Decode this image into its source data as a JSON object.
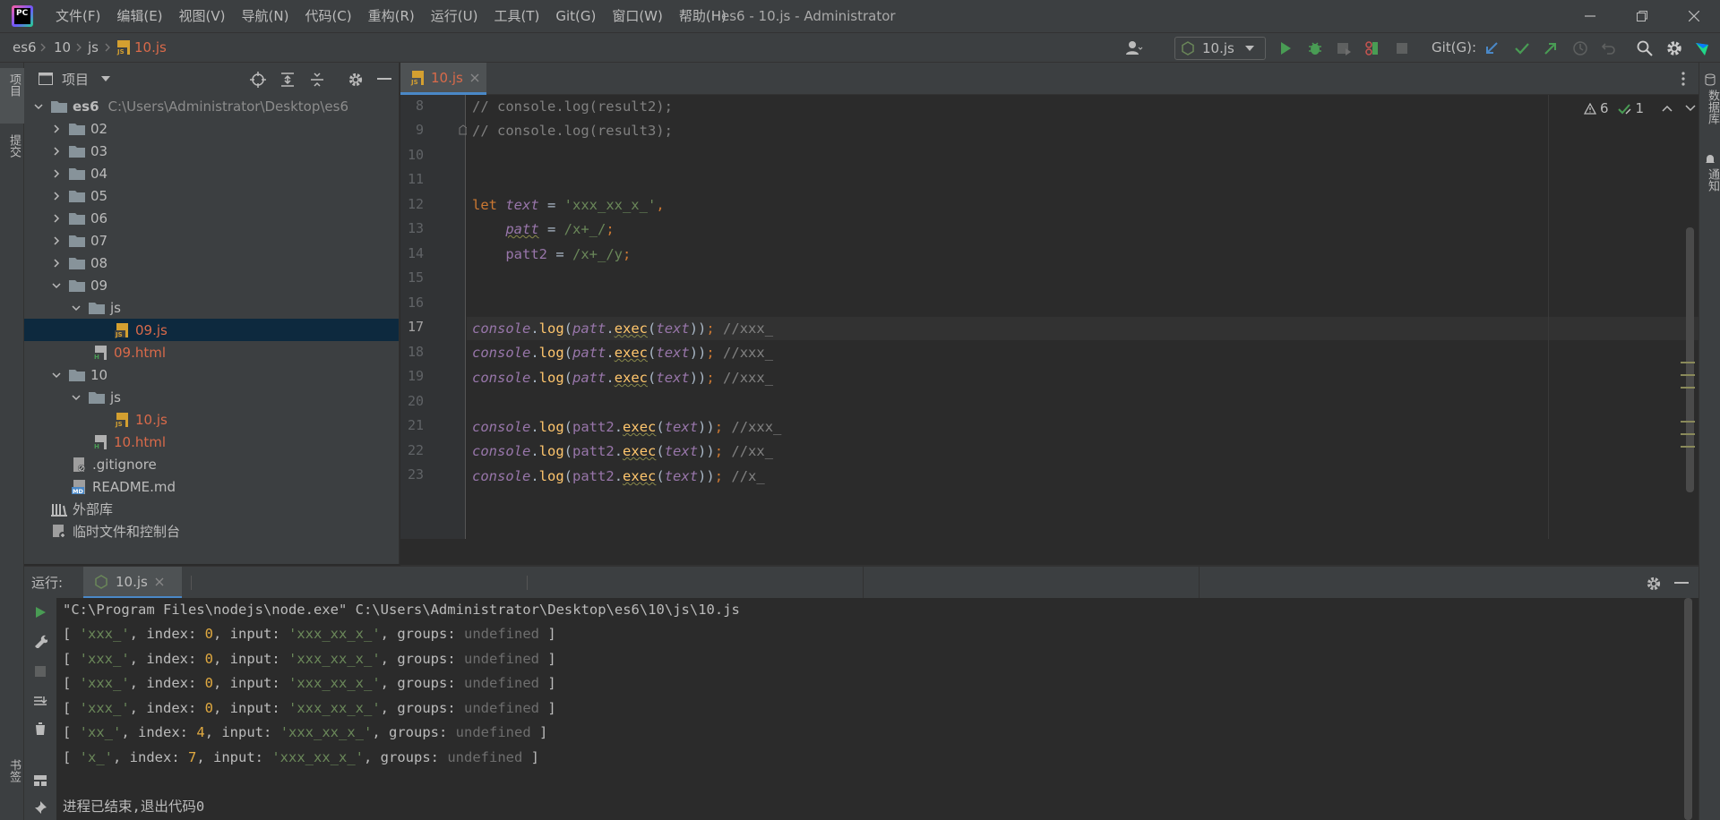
{
  "titlebar": {
    "menu": [
      "文件(F)",
      "编辑(E)",
      "视图(V)",
      "导航(N)",
      "代码(C)",
      "重构(R)",
      "运行(U)",
      "工具(T)",
      "Git(G)",
      "窗口(W)",
      "帮助(H)"
    ],
    "window_title": "es6 - 10.js - Administrator"
  },
  "navbar": {
    "breadcrumb": [
      "es6",
      "10",
      "js",
      "10.js"
    ],
    "run_config": "10.js",
    "git_label": "Git(G):"
  },
  "left_strip": {
    "project_tab": "项目",
    "commit_tab": "提交",
    "bookmarks_tab": "书签"
  },
  "right_strip": {
    "database_tab": "数据库",
    "notifications_tab": "通知"
  },
  "project": {
    "header": "项目",
    "root_name": "es6",
    "root_path": "C:\\Users\\Administrator\\Desktop\\es6",
    "items": [
      "02",
      "03",
      "04",
      "05",
      "06",
      "07",
      "08",
      "09",
      "js",
      "09.js",
      "09.html",
      "10",
      "js",
      "10.js",
      "10.html",
      ".gitignore",
      "README.md",
      "外部库",
      "临时文件和控制台"
    ]
  },
  "editor": {
    "tab": "10.js",
    "line_numbers": [
      "8",
      "9",
      "10",
      "11",
      "12",
      "13",
      "14",
      "15",
      "16",
      "17",
      "18",
      "19",
      "20",
      "21",
      "22",
      "23"
    ],
    "warnings": "6",
    "weak_warnings": "1"
  },
  "run": {
    "label": "运行:",
    "tab": "10.js",
    "command": "\"C:\\Program Files\\nodejs\\node.exe\" C:\\Users\\Administrator\\Desktop\\es6\\10\\js\\10.js",
    "exit_message": "进程已结束,退出代码0"
  },
  "colors": {
    "accent": "#4a88c7",
    "run_green": "#499c54",
    "selection": "#0d293e"
  }
}
